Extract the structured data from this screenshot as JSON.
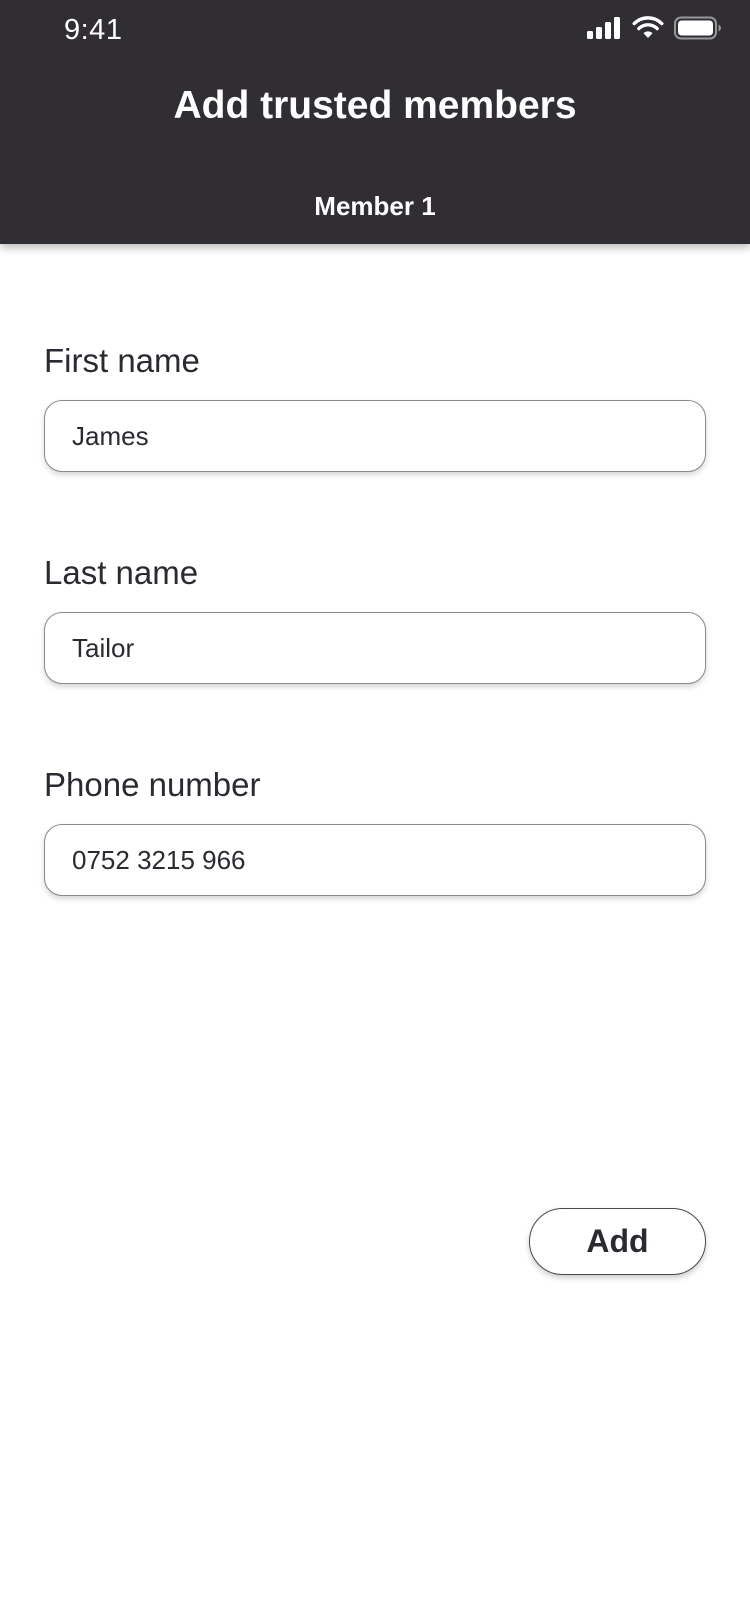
{
  "status_bar": {
    "time": "9:41",
    "icons": [
      "cellular-signal-icon",
      "wifi-icon",
      "battery-icon"
    ]
  },
  "header": {
    "title": "Add trusted members",
    "subtitle": "Member 1"
  },
  "form": {
    "first_name": {
      "label": "First name",
      "value": "James"
    },
    "last_name": {
      "label": "Last name",
      "value": "Tailor"
    },
    "phone_number": {
      "label": "Phone number",
      "value": "0752 3215 966"
    }
  },
  "actions": {
    "add_label": "Add"
  },
  "colors": {
    "header_background": "#302d33",
    "text": "#2b2a30",
    "background": "#ffffff"
  }
}
